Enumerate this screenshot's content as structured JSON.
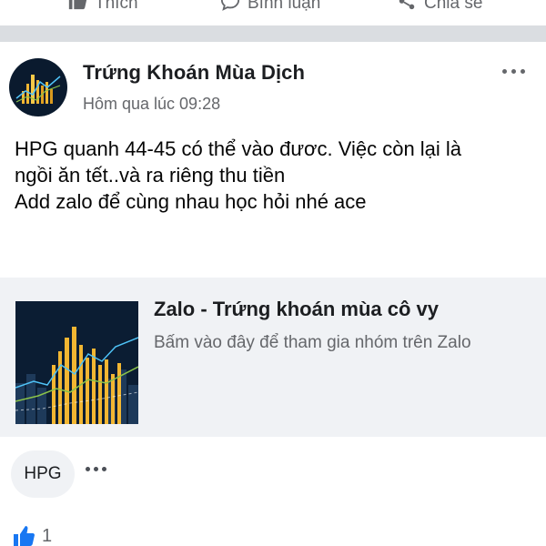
{
  "actions": {
    "like_label": "Thích",
    "comment_label": "Bình luận",
    "share_label": "Chia sẻ"
  },
  "post": {
    "author": "Trứng Khoán Mùa Dịch",
    "timestamp": "Hôm qua lúc 09:28",
    "text_lines": [
      "HPG quanh 44-45 có thể vào đươc. Việc còn lại là",
      "ngồi ăn tết..và ra riêng thu tiền",
      "Add zalo để cùng nhau học hỏi nhé ace"
    ]
  },
  "link_preview": {
    "title": "Zalo - Trứng khoán mùa cô vy",
    "description": "Bấm vào đây để tham gia nhóm trên Zalo"
  },
  "tags": {
    "items": [
      "HPG"
    ]
  },
  "reactions": {
    "count": "1",
    "icon": "thumbs-up-icon"
  },
  "colors": {
    "accent": "#1877f2",
    "secondary_text": "#65676b",
    "card_bg": "#f0f2f5",
    "separator": "#dadde1"
  }
}
